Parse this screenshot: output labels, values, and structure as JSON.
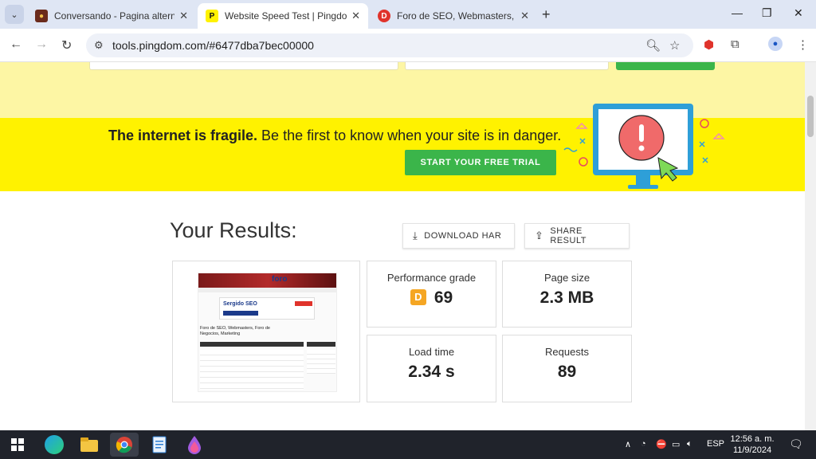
{
  "browser": {
    "tabs": [
      {
        "title": "Conversando - Pagina alternativa",
        "active": false
      },
      {
        "title": "Website Speed Test | Pingdom Tools",
        "active": true
      },
      {
        "title": "Foro de SEO, Webmasters, Foro de Negocios",
        "active": false
      }
    ],
    "new_tab": "+",
    "url": "tools.pingdom.com/#6477dba7bec00000"
  },
  "banner": {
    "bold_text": "The internet is fragile.",
    "text": " Be the first to know when your site is in danger.",
    "cta": "START YOUR FREE TRIAL"
  },
  "results": {
    "title": "Your Results:",
    "download_har": "DOWNLOAD HAR",
    "share_result": "SHARE RESULT",
    "metrics": {
      "performance_grade_label": "Performance grade",
      "grade_letter": "D",
      "grade_value": "69",
      "page_size_label": "Page size",
      "page_size_value": "2.3 MB",
      "load_time_label": "Load time",
      "load_time_value": "2.34 s",
      "requests_label": "Requests",
      "requests_value": "89"
    }
  },
  "thumbnail": {
    "site_logo": "foro",
    "banner_brand": "Sergido SEO",
    "heading": "Foro de SEO, Webmasters, Foro de Negocios, Marketing"
  },
  "taskbar": {
    "language": "ESP",
    "time": "12:56 a. m.",
    "date": "11/9/2024"
  },
  "colors": {
    "banner_yellow": "#fff200",
    "cta_green": "#3bb54a",
    "grade_orange": "#f5a623"
  }
}
